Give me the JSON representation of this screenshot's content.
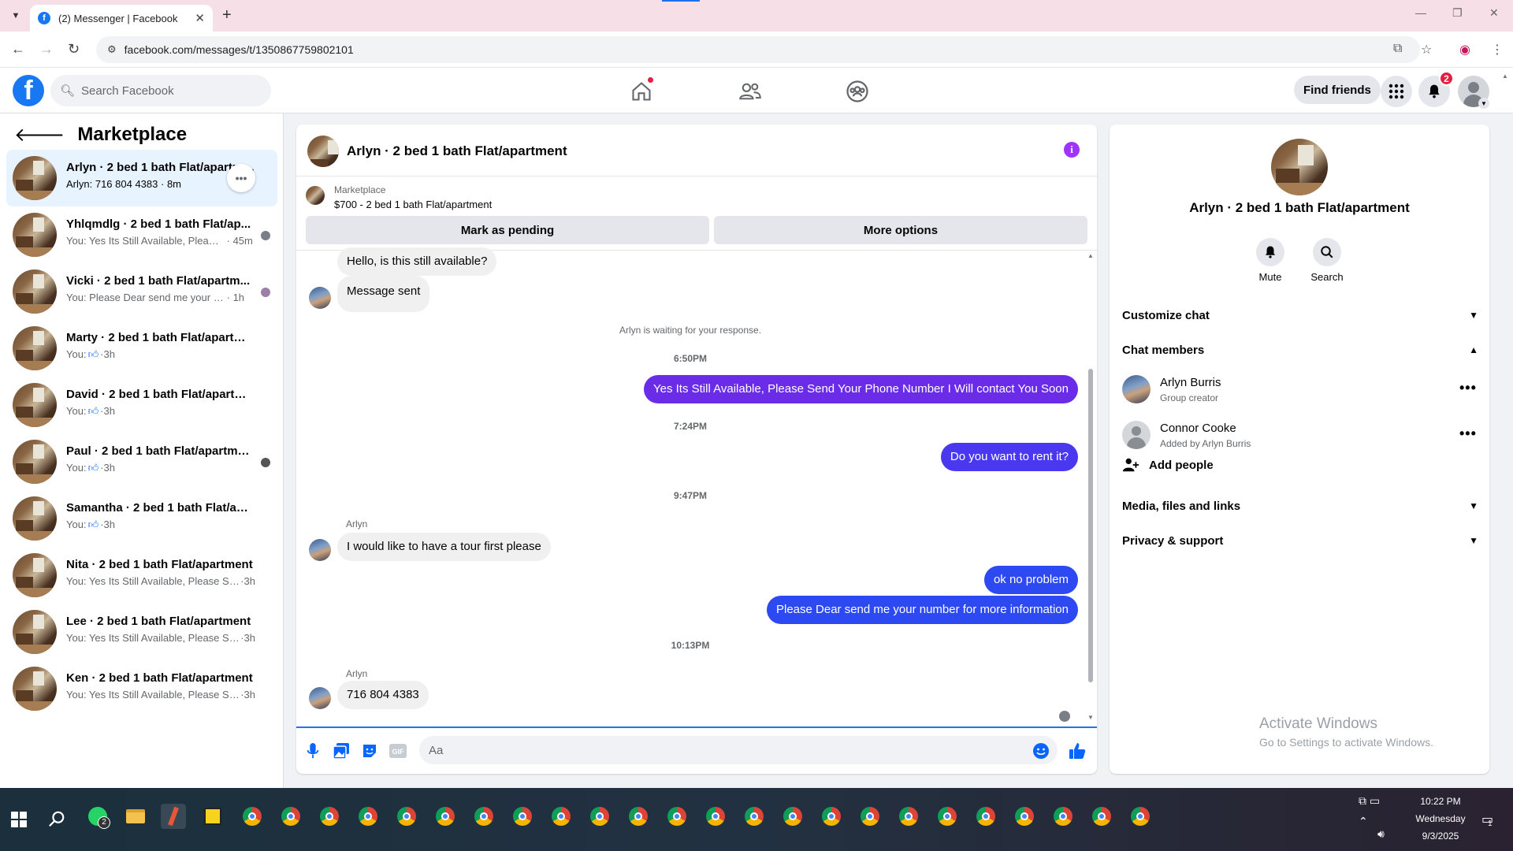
{
  "browser": {
    "tab_title": "(2) Messenger | Facebook",
    "url": "facebook.com/messages/t/1350867759802101"
  },
  "header": {
    "search_placeholder": "Search Facebook",
    "find_friends": "Find friends",
    "notification_count": "2"
  },
  "sidebar": {
    "title": "Marketplace",
    "conversations": [
      {
        "name": "Arlyn · 2 bed 1 bath Flat/apartment",
        "snippet": "Arlyn: 716 804 4383",
        "time": "8m",
        "active": true,
        "unread": true
      },
      {
        "name": "Yhlqmdlg · 2 bed 1 bath Flat/ap...",
        "snippet": "You: Yes Its Still Available, Please ...",
        "time": "45m"
      },
      {
        "name": "Vicki · 2 bed 1 bath Flat/apartm...",
        "snippet": "You: Please Dear send me your nu...",
        "time": "1h"
      },
      {
        "name": "Marty · 2 bed 1 bath Flat/apartment",
        "snippet": "You:",
        "time": "3h",
        "like": true
      },
      {
        "name": "David · 2 bed 1 bath Flat/apartment",
        "snippet": "You:",
        "time": "3h",
        "like": true
      },
      {
        "name": "Paul · 2 bed 1 bath Flat/apartment",
        "snippet": "You:",
        "time": "3h",
        "like": true
      },
      {
        "name": "Samantha · 2 bed 1 bath Flat/apart...",
        "snippet": "You:",
        "time": "3h",
        "like": true
      },
      {
        "name": "Nita · 2 bed 1 bath Flat/apartment",
        "snippet": "You: Yes Its Still Available, Please Send...",
        "time": "3h"
      },
      {
        "name": "Lee · 2 bed 1 bath Flat/apartment",
        "snippet": "You: Yes Its Still Available, Please Send...",
        "time": "3h"
      },
      {
        "name": "Ken · 2 bed 1 bath Flat/apartment",
        "snippet": "You: Yes Its Still Available, Please Send...",
        "time": "3h"
      }
    ]
  },
  "chat": {
    "title": "Arlyn · 2 bed 1 bath Flat/apartment",
    "marketplace_label": "Marketplace",
    "listing": "$700 - 2 bed 1 bath Flat/apartment",
    "mark_pending": "Mark as pending",
    "more_options": "More options",
    "messages": {
      "m1": "Hello, is this still available?",
      "m2": "Message sent",
      "waiting": "Arlyn is waiting for your response.",
      "t1": "6:50PM",
      "m3": "Yes Its Still Available, Please Send Your Phone Number I Will contact You Soon",
      "t2": "7:24PM",
      "m4": "Do you want to rent it?",
      "t3": "9:47PM",
      "sender1": "Arlyn",
      "m5": "I would like to have a tour first please",
      "m6": "ok no problem",
      "m7": "Please Dear send me your number for more information",
      "t4": "10:13PM",
      "sender2": "Arlyn",
      "m8": "716 804 4383"
    },
    "composer_placeholder": "Aa"
  },
  "info": {
    "title": "Arlyn · 2 bed 1 bath Flat/apartment",
    "mute": "Mute",
    "search": "Search",
    "customize_chat": "Customize chat",
    "chat_members": "Chat members",
    "members": [
      {
        "name": "Arlyn Burris",
        "role": "Group creator"
      },
      {
        "name": "Connor Cooke",
        "role": "Added by Arlyn Burris"
      }
    ],
    "add_people": "Add people",
    "media": "Media, files and links",
    "privacy": "Privacy & support"
  },
  "watermark": {
    "line1": "Activate Windows",
    "line2": "Go to Settings to activate Windows."
  },
  "taskbar": {
    "whatsapp_badge": "2",
    "time": "10:22 PM",
    "day": "Wednesday",
    "date": "9/3/2025",
    "notif_count": "1"
  },
  "colors": {
    "fb_blue": "#1877f2",
    "outgoing_1": "#6b2ce8",
    "outgoing_2": "#4a38f0",
    "outgoing_3": "#2c49f2",
    "info_purple": "#a033ff"
  }
}
